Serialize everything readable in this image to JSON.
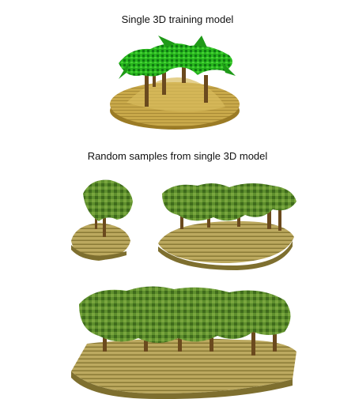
{
  "figure": {
    "title_top": "Single 3D training model",
    "title_bottom": "Random samples from single 3D model"
  },
  "colors": {
    "ground": "#c9a94a",
    "ground_dark": "#9b7b25",
    "ground_light": "#e3c977",
    "trunk": "#6b4a1e",
    "palm_leaf": "#27b51d",
    "palm_leaf_dark": "#0f7a12",
    "tree_leaf": "#5e8f2d",
    "tree_leaf_dark": "#2f5a16",
    "sample_ground": "#b9a65b",
    "sample_ground_dark": "#7e6f2f"
  },
  "icons": [
    "palm-tree-icon",
    "voxel-tree-icon"
  ]
}
